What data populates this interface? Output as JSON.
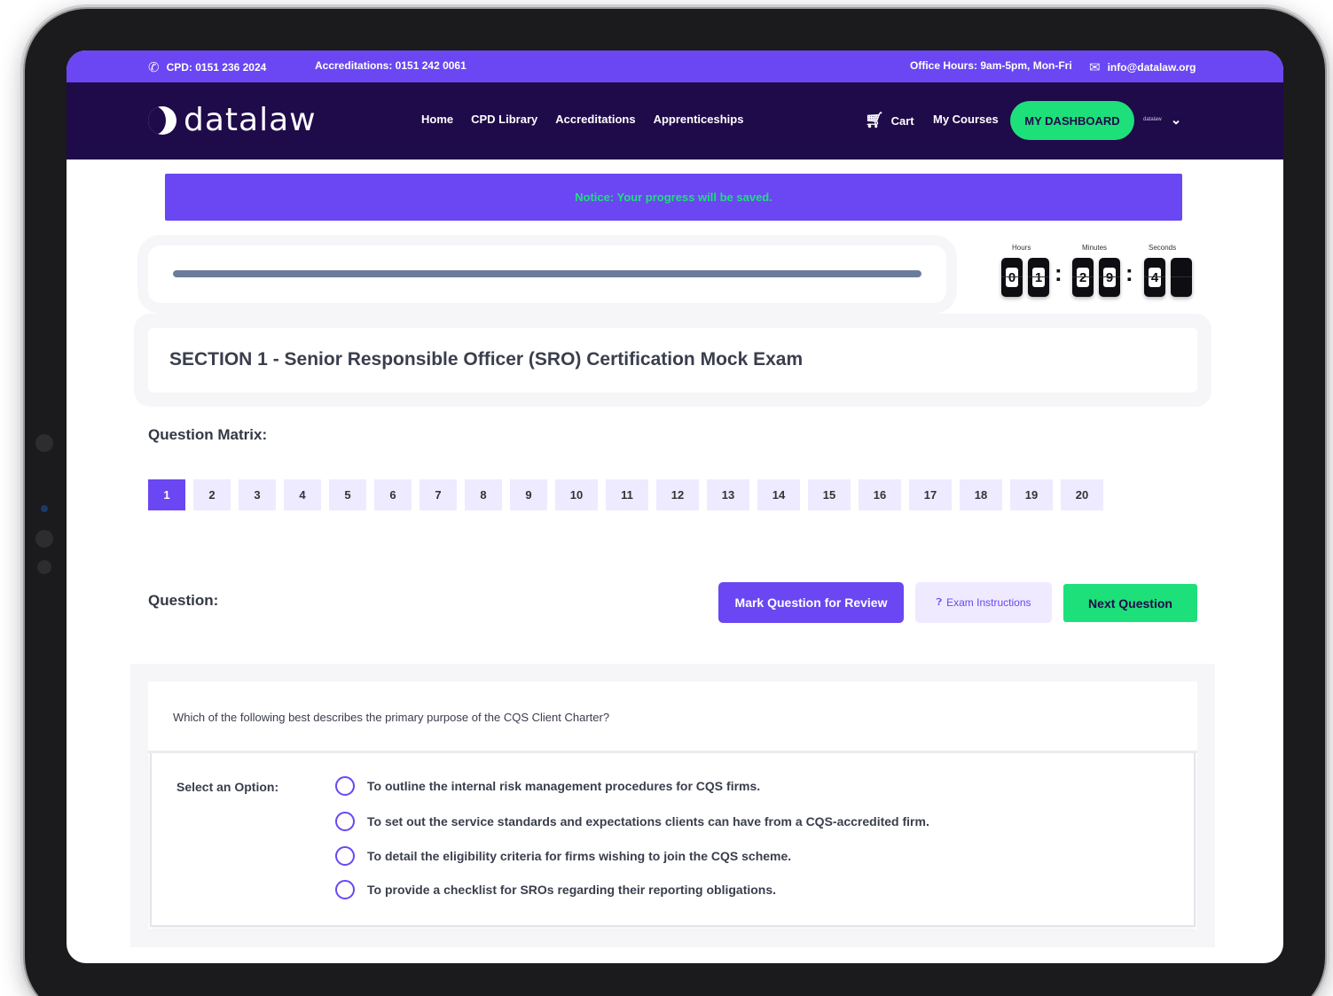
{
  "topbar": {
    "phone_cpd": "CPD: 0151 236 2024",
    "phone_accreditations": "Accreditations: 0151 242 0061",
    "office_hours": "Office Hours: 9am-5pm, Mon-Fri",
    "email": "info@datalaw.org"
  },
  "brand": {
    "name": "datalaw"
  },
  "nav": {
    "links": [
      "Home",
      "CPD Library",
      "Accreditations",
      "Apprenticeships"
    ],
    "cart": "Cart",
    "my_courses": "My Courses",
    "dashboard": "MY DASHBOARD",
    "user": "datalaw"
  },
  "notice": "Notice: Your progress will be saved.",
  "progress": {
    "fraction": 1.0
  },
  "timer": {
    "labels": {
      "hours": "Hours",
      "minutes": "Minutes",
      "seconds": "Seconds"
    },
    "hours": [
      "0",
      "1"
    ],
    "minutes": [
      "2",
      "9"
    ],
    "seconds": [
      "4",
      ""
    ]
  },
  "section_title": "SECTION 1 - Senior Responsible Officer (SRO) Certification Mock Exam",
  "matrix": {
    "label": "Question Matrix:",
    "numbers": [
      "1",
      "2",
      "3",
      "4",
      "5",
      "6",
      "7",
      "8",
      "9",
      "10",
      "11",
      "12",
      "13",
      "14",
      "15",
      "16",
      "17",
      "18",
      "19",
      "20"
    ],
    "active": "1"
  },
  "question": {
    "label": "Question:",
    "buttons": {
      "review": "Mark Question for Review",
      "instructions": "Exam Instructions",
      "next": "Next Question"
    },
    "text": "Which of the following best describes the primary purpose of the CQS Client Charter?",
    "select_label": "Select an Option:",
    "options": [
      "To outline the internal risk management procedures for CQS firms.",
      "To set out the service standards and expectations clients can have from a CQS-accredited firm.",
      "To detail the eligibility criteria for firms wishing to join the CQS scheme.",
      "To provide a checklist for SROs regarding their reporting obligations."
    ]
  },
  "colors": {
    "brand_purple": "#6a47f2",
    "nav_dark": "#1f0a4a",
    "accent_green": "#1de07a"
  }
}
